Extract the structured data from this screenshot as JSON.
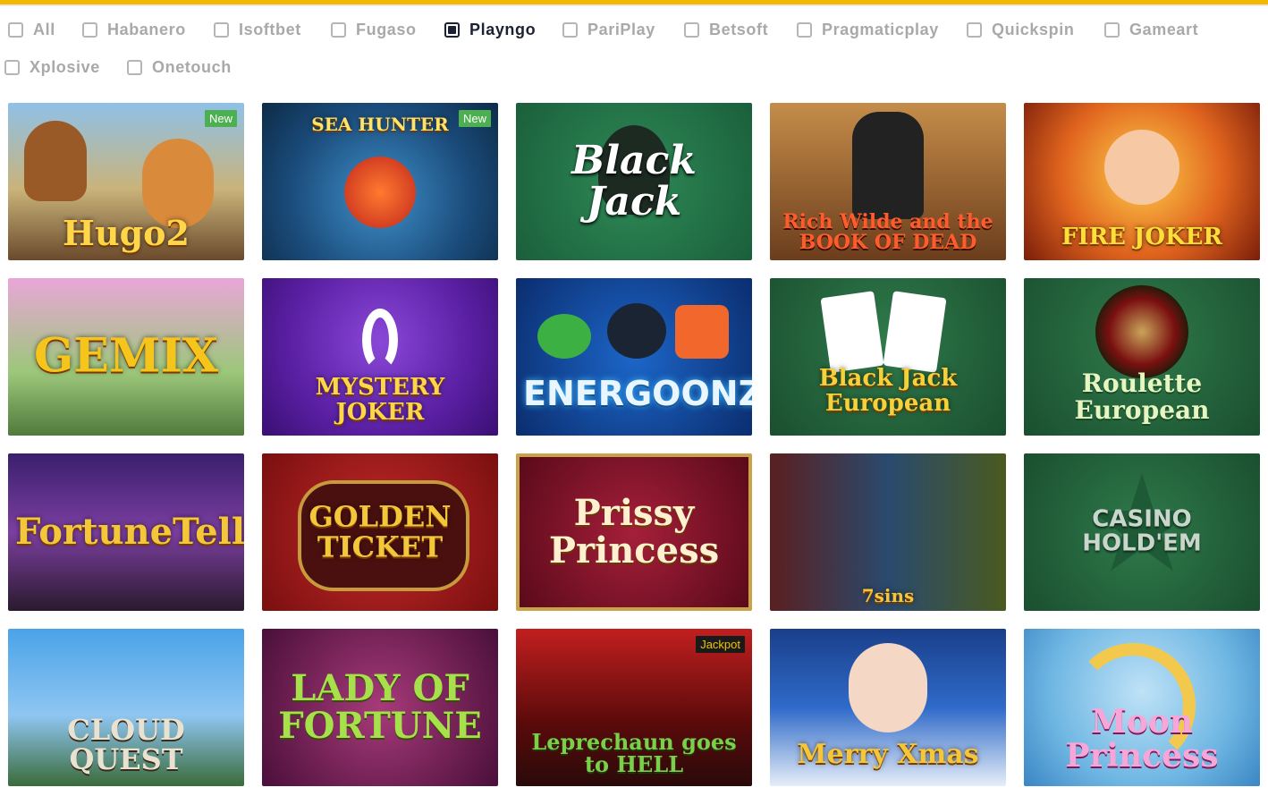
{
  "filters": [
    {
      "label": "All",
      "checked": false
    },
    {
      "label": "Habanero",
      "checked": false
    },
    {
      "label": "Isoftbet",
      "checked": false
    },
    {
      "label": "Fugaso",
      "checked": false
    },
    {
      "label": "Playngo",
      "checked": true
    },
    {
      "label": "PariPlay",
      "checked": false
    },
    {
      "label": "Betsoft",
      "checked": false
    },
    {
      "label": "Pragmaticplay",
      "checked": false
    },
    {
      "label": "Quickspin",
      "checked": false
    },
    {
      "label": "Gameart",
      "checked": false
    },
    {
      "label": "Xplosive",
      "checked": false
    },
    {
      "label": "Onetouch",
      "checked": false
    }
  ],
  "games": [
    {
      "title": "Hugo2",
      "badge": "New"
    },
    {
      "title": "SEA HUNTER",
      "badge": "New"
    },
    {
      "title": "Black Jack",
      "badge": ""
    },
    {
      "title": "Rich Wilde and the BOOK OF DEAD",
      "badge": ""
    },
    {
      "title": "FIRE JOKER",
      "badge": ""
    },
    {
      "title": "GEMIX",
      "badge": ""
    },
    {
      "title": "MYSTERY JOKER",
      "badge": ""
    },
    {
      "title": "ENERGOONZ",
      "badge": ""
    },
    {
      "title": "Black Jack European",
      "badge": ""
    },
    {
      "title": "Roulette European",
      "badge": ""
    },
    {
      "title": "FortuneTeller",
      "badge": ""
    },
    {
      "title": "GOLDEN TICKET",
      "badge": ""
    },
    {
      "title": "Prissy Princess",
      "badge": ""
    },
    {
      "title": "7sins",
      "badge": ""
    },
    {
      "title": "CASINO HOLD'EM",
      "badge": ""
    },
    {
      "title": "CLOUD QUEST",
      "badge": ""
    },
    {
      "title": "LADY OF FORTUNE",
      "badge": ""
    },
    {
      "title": "Leprechaun goes to HELL",
      "badge": "Jackpot"
    },
    {
      "title": "Merry Xmas",
      "badge": ""
    },
    {
      "title": "Moon Princess",
      "badge": ""
    }
  ],
  "colors": {
    "accent": "#f5b800",
    "checked_text": "#1c2233",
    "unchecked_text": "#a9a9a9",
    "badge_new": "#4caf50",
    "badge_jackpot": "#1a1a1a"
  }
}
